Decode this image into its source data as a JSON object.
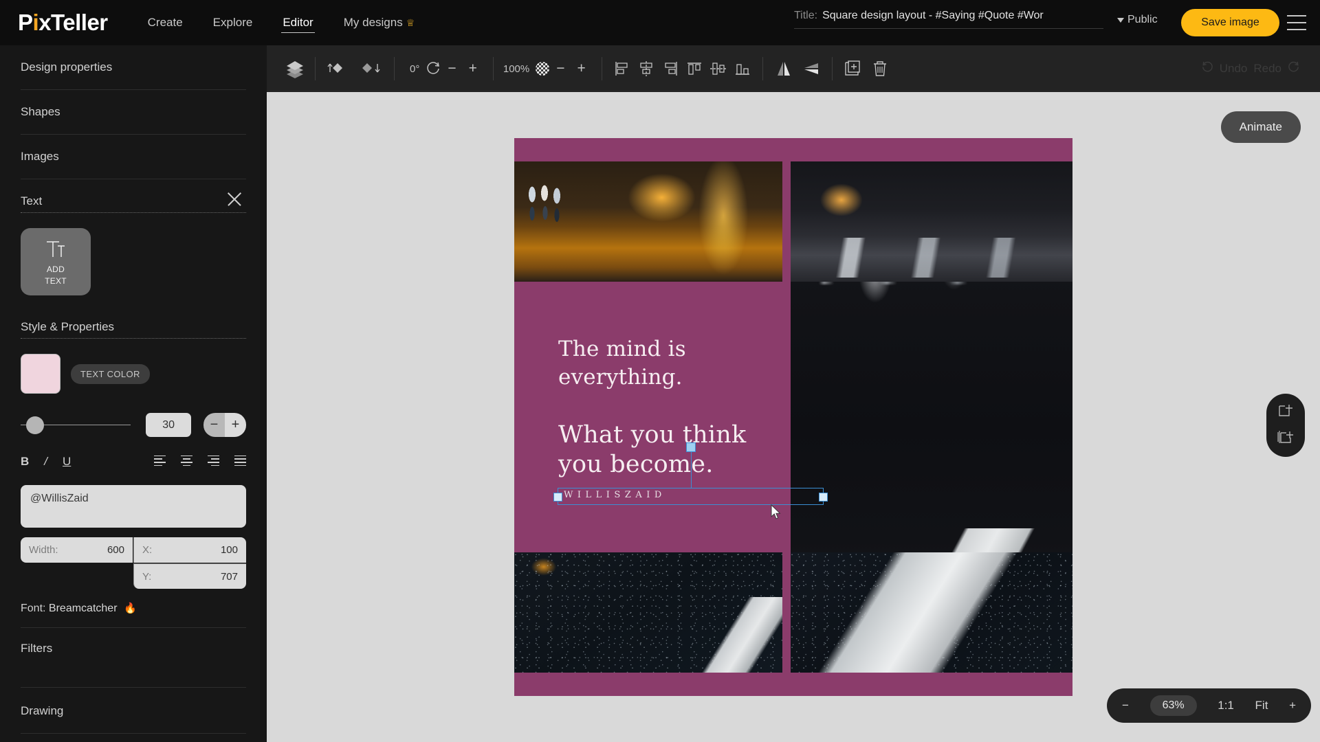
{
  "brand": {
    "name_pre": "P",
    "name_dot": "i",
    "name_post": "xTeller"
  },
  "nav": [
    {
      "label": "Create",
      "active": false
    },
    {
      "label": "Explore",
      "active": false
    },
    {
      "label": "Editor",
      "active": true
    },
    {
      "label": "My designs",
      "active": false,
      "badge": "crown"
    }
  ],
  "header": {
    "title_label": "Title:",
    "title_value": "Square design layout - #Saying #Quote #Wor",
    "visibility": "Public",
    "save_label": "Save image",
    "menu_icon": "hamburger-icon"
  },
  "sidebar": {
    "sections": [
      {
        "label": "Design properties"
      },
      {
        "label": "Shapes"
      },
      {
        "label": "Images"
      },
      {
        "label": "Text",
        "open": true,
        "close_icon": "close-icon"
      }
    ],
    "add_text": {
      "icon": "add-text-icon",
      "line1": "ADD",
      "line2": "TEXT"
    },
    "style_title": "Style & Properties",
    "text_color": {
      "label": "TEXT COLOR",
      "value": "#f0d5de"
    },
    "font_size": {
      "value": "30",
      "minus": "−",
      "plus": "+"
    },
    "format": {
      "bold": "B",
      "italic": "/",
      "underline": "U"
    },
    "align": [
      "align-left-icon",
      "align-center-icon",
      "align-right-icon",
      "align-justify-icon"
    ],
    "text_value": "@WillisZaid",
    "fields": [
      {
        "key": "Width:",
        "value": "600"
      },
      {
        "key": "X:",
        "value": "100"
      },
      {
        "key": "Y:",
        "value": "707"
      }
    ],
    "font_row": {
      "label": "Font:",
      "name": "Breamcatcher",
      "badge": "flame-icon"
    },
    "filters_label": "Filters",
    "drawing_label": "Drawing"
  },
  "toolbar": {
    "layers_icon": "layers-icon",
    "bring_forward_icon": "bring-forward-icon",
    "send_backward_icon": "send-backward-icon",
    "rotation_value": "0°",
    "rotate_icon": "rotate-icon",
    "rotate_minus": "−",
    "rotate_plus": "+",
    "opacity_value": "100%",
    "opacity_icon": "transparency-icon",
    "opacity_minus": "−",
    "opacity_plus": "+",
    "align_icons": [
      "align-left-edge-icon",
      "align-h-center-icon",
      "align-right-edge-icon",
      "align-top-edge-icon",
      "align-v-center-icon",
      "align-bottom-edge-icon"
    ],
    "flip_h_icon": "flip-horizontal-icon",
    "flip_v_icon": "flip-vertical-icon",
    "duplicate_icon": "duplicate-icon",
    "delete_icon": "trash-icon",
    "undo_label": "Undo",
    "redo_label": "Redo",
    "undo_icon": "undo-icon",
    "redo_icon": "redo-icon"
  },
  "canvas": {
    "background_color": "#8b3c6b",
    "quote_line1": "The mind is",
    "quote_line2": "everything.",
    "quote_line3": "What you think",
    "quote_line4": "you become.",
    "selected_object_text": "WILLISZAID",
    "photos": [
      {
        "name": "photo-top-left",
        "desc": "night street with people and orange storefront lights"
      },
      {
        "name": "photo-top-right",
        "desc": "wet crosswalk at night"
      },
      {
        "name": "photo-right-tall",
        "desc": "dark wet asphalt with light reflections"
      },
      {
        "name": "photo-bottom-left",
        "desc": "dark asphalt texture with crosswalk stripe"
      },
      {
        "name": "photo-bottom-right",
        "desc": "white crosswalk stripe on asphalt"
      }
    ]
  },
  "floating": {
    "animate_label": "Animate",
    "add_frame_icon": "add-frame-icon",
    "duplicate_frame_icon": "duplicate-frame-icon",
    "zoom": {
      "minus": "−",
      "percent": "63%",
      "one_to_one": "1:1",
      "fit": "Fit",
      "plus": "+"
    }
  }
}
